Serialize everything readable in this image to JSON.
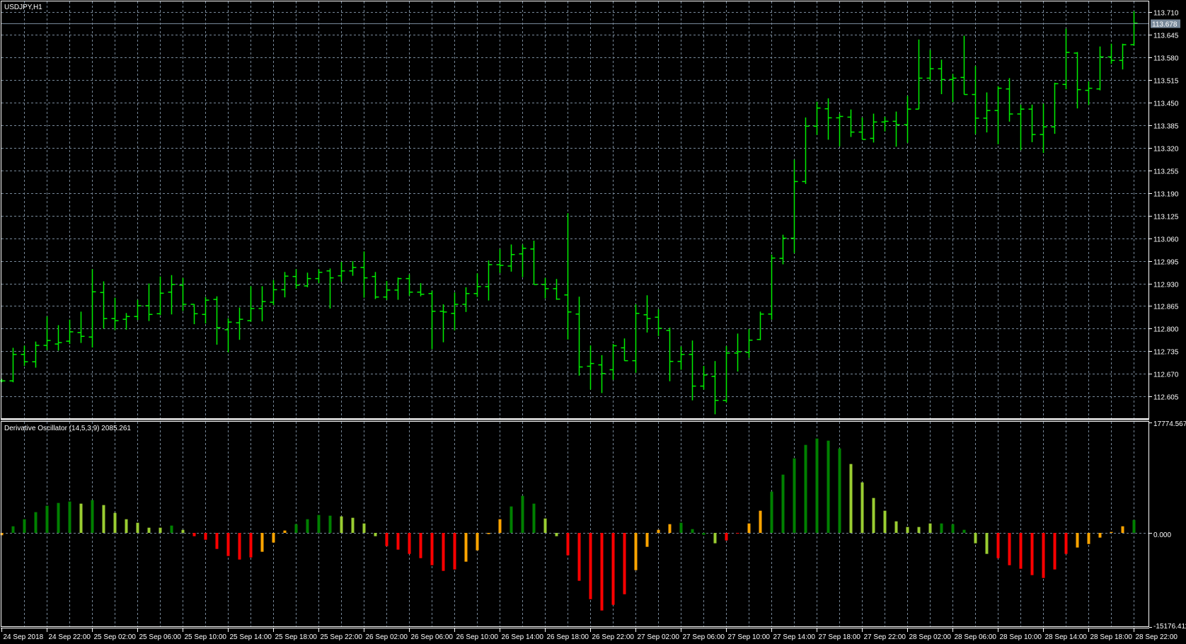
{
  "window": {
    "symbol_label": "USDJPY,H1",
    "indicator_label": "Derivative Oscillator (14,5,3,9) 2085.261"
  },
  "colors": {
    "background": "#000000",
    "grid": "#778899",
    "bar": "#00ee00",
    "osc_up_strong": "#008000",
    "osc_up_weak": "#9acd32",
    "osc_down_strong": "#ff0000",
    "osc_down_weak": "#ffa500",
    "price_line": "#778899"
  },
  "chart_data": [
    {
      "type": "ohlc",
      "title": "USDJPY,H1",
      "ylim": [
        112.57,
        113.74
      ],
      "price_ticks": [
        "113.710",
        "113.645",
        "113.580",
        "113.515",
        "113.450",
        "113.385",
        "113.320",
        "113.255",
        "113.190",
        "113.125",
        "113.060",
        "112.995",
        "112.930",
        "112.865",
        "112.800",
        "112.735",
        "112.670",
        "112.605"
      ],
      "current_price": "113.678",
      "time_labels": [
        {
          "bar": 0,
          "text": "24 Sep 2018"
        },
        {
          "bar": 4,
          "text": "24 Sep 22:00"
        },
        {
          "bar": 8,
          "text": "25 Sep 02:00"
        },
        {
          "bar": 12,
          "text": "25 Sep 06:00"
        },
        {
          "bar": 16,
          "text": "25 Sep 10:00"
        },
        {
          "bar": 20,
          "text": "25 Sep 14:00"
        },
        {
          "bar": 24,
          "text": "25 Sep 18:00"
        },
        {
          "bar": 28,
          "text": "25 Sep 22:00"
        },
        {
          "bar": 32,
          "text": "26 Sep 02:00"
        },
        {
          "bar": 36,
          "text": "26 Sep 06:00"
        },
        {
          "bar": 40,
          "text": "26 Sep 10:00"
        },
        {
          "bar": 44,
          "text": "26 Sep 14:00"
        },
        {
          "bar": 48,
          "text": "26 Sep 18:00"
        },
        {
          "bar": 52,
          "text": "26 Sep 22:00"
        },
        {
          "bar": 56,
          "text": "27 Sep 02:00"
        },
        {
          "bar": 60,
          "text": "27 Sep 06:00"
        },
        {
          "bar": 64,
          "text": "27 Sep 10:00"
        },
        {
          "bar": 68,
          "text": "27 Sep 14:00"
        },
        {
          "bar": 72,
          "text": "27 Sep 18:00"
        },
        {
          "bar": 76,
          "text": "27 Sep 22:00"
        },
        {
          "bar": 80,
          "text": "28 Sep 02:00"
        },
        {
          "bar": 84,
          "text": "28 Sep 06:00"
        },
        {
          "bar": 88,
          "text": "28 Sep 10:00"
        },
        {
          "bar": 92,
          "text": "28 Sep 14:00"
        },
        {
          "bar": 96,
          "text": "28 Sep 18:00"
        },
        {
          "bar": 100,
          "text": "28 Sep 22:00"
        }
      ],
      "ohlc": [
        [
          112.65,
          112.656,
          112.646,
          112.65
        ],
        [
          112.65,
          112.745,
          112.646,
          112.726
        ],
        [
          112.726,
          112.751,
          112.693,
          112.705
        ],
        [
          112.705,
          112.763,
          112.688,
          112.752
        ],
        [
          112.752,
          112.835,
          112.739,
          112.766
        ],
        [
          112.756,
          112.81,
          112.737,
          112.76
        ],
        [
          112.764,
          112.826,
          112.756,
          112.791
        ],
        [
          112.789,
          112.849,
          112.759,
          112.778
        ],
        [
          112.776,
          112.971,
          112.746,
          112.906
        ],
        [
          112.904,
          112.936,
          112.8,
          112.829
        ],
        [
          112.829,
          112.889,
          112.796,
          112.823
        ],
        [
          112.827,
          112.845,
          112.797,
          112.835
        ],
        [
          112.835,
          112.883,
          112.825,
          112.866
        ],
        [
          112.866,
          112.93,
          112.822,
          112.841
        ],
        [
          112.843,
          112.95,
          112.839,
          112.902
        ],
        [
          112.905,
          112.954,
          112.841,
          112.927
        ],
        [
          112.925,
          112.946,
          112.851,
          112.87
        ],
        [
          112.87,
          112.87,
          112.813,
          112.843
        ],
        [
          112.841,
          112.891,
          112.815,
          112.882
        ],
        [
          112.884,
          112.893,
          112.754,
          112.803
        ],
        [
          112.797,
          112.83,
          112.732,
          112.819
        ],
        [
          112.817,
          112.861,
          112.768,
          112.827
        ],
        [
          112.823,
          112.922,
          112.82,
          112.858
        ],
        [
          112.858,
          112.922,
          112.821,
          112.878
        ],
        [
          112.876,
          112.94,
          112.868,
          112.912
        ],
        [
          112.912,
          112.963,
          112.89,
          112.951
        ],
        [
          112.95,
          112.971,
          112.915,
          112.925
        ],
        [
          112.923,
          112.961,
          112.919,
          112.944
        ],
        [
          112.944,
          112.971,
          112.931,
          112.962
        ],
        [
          112.966,
          112.973,
          112.858,
          112.946
        ],
        [
          112.952,
          112.992,
          112.935,
          112.966
        ],
        [
          112.966,
          112.994,
          112.952,
          112.976
        ],
        [
          112.976,
          113.022,
          112.889,
          112.946
        ],
        [
          112.95,
          112.963,
          112.885,
          112.891
        ],
        [
          112.891,
          112.937,
          112.883,
          112.911
        ],
        [
          112.911,
          112.947,
          112.883,
          112.944
        ],
        [
          112.944,
          112.956,
          112.895,
          112.905
        ],
        [
          112.905,
          112.931,
          112.893,
          112.899
        ],
        [
          112.901,
          112.909,
          112.741,
          112.85
        ],
        [
          112.85,
          112.87,
          112.761,
          112.848
        ],
        [
          112.844,
          112.904,
          112.795,
          112.87
        ],
        [
          112.87,
          112.919,
          112.848,
          112.901
        ],
        [
          112.901,
          112.959,
          112.891,
          112.921
        ],
        [
          112.921,
          112.996,
          112.881,
          112.984
        ],
        [
          112.984,
          113.029,
          112.96,
          112.982
        ],
        [
          112.98,
          113.042,
          112.964,
          113.013
        ],
        [
          113.015,
          113.042,
          112.948,
          113.031
        ],
        [
          113.029,
          113.053,
          112.927,
          112.927
        ],
        [
          112.927,
          112.946,
          112.887,
          112.915
        ],
        [
          112.915,
          112.943,
          112.883,
          112.885
        ],
        [
          112.897,
          113.132,
          112.769,
          112.848
        ],
        [
          112.842,
          112.892,
          112.665,
          112.69
        ],
        [
          112.692,
          112.752,
          112.625,
          112.7
        ],
        [
          112.696,
          112.724,
          112.615,
          112.671
        ],
        [
          112.682,
          112.756,
          112.653,
          112.751
        ],
        [
          112.745,
          112.772,
          112.708,
          112.708
        ],
        [
          112.708,
          112.87,
          112.673,
          112.844
        ],
        [
          112.84,
          112.896,
          112.789,
          112.829
        ],
        [
          112.833,
          112.856,
          112.779,
          112.801
        ],
        [
          112.795,
          112.803,
          112.649,
          112.706
        ],
        [
          112.706,
          112.749,
          112.682,
          112.726
        ],
        [
          112.726,
          112.766,
          112.594,
          112.635
        ],
        [
          112.635,
          112.693,
          112.625,
          112.667
        ],
        [
          112.663,
          112.707,
          112.554,
          112.594
        ],
        [
          112.594,
          112.75,
          112.588,
          112.73
        ],
        [
          112.73,
          112.786,
          112.677,
          112.734
        ],
        [
          112.732,
          112.799,
          112.716,
          112.767
        ],
        [
          112.769,
          112.849,
          112.767,
          112.842
        ],
        [
          112.842,
          113.013,
          112.826,
          113.003
        ],
        [
          113.002,
          113.07,
          112.985,
          113.06
        ],
        [
          113.06,
          113.286,
          113.017,
          113.223
        ],
        [
          113.223,
          113.407,
          113.216,
          113.382
        ],
        [
          113.382,
          113.452,
          113.357,
          113.434
        ],
        [
          113.432,
          113.462,
          113.343,
          113.406
        ],
        [
          113.406,
          113.418,
          113.324,
          113.41
        ],
        [
          113.408,
          113.43,
          113.351,
          113.365
        ],
        [
          113.365,
          113.407,
          113.344,
          113.344
        ],
        [
          113.347,
          113.418,
          113.335,
          113.394
        ],
        [
          113.394,
          113.409,
          113.367,
          113.396
        ],
        [
          113.396,
          113.424,
          113.323,
          113.386
        ],
        [
          113.386,
          113.469,
          113.334,
          113.431
        ],
        [
          113.431,
          113.631,
          113.431,
          113.52
        ],
        [
          113.52,
          113.601,
          113.512,
          113.547
        ],
        [
          113.547,
          113.573,
          113.474,
          113.516
        ],
        [
          113.516,
          113.532,
          113.451,
          113.52
        ],
        [
          113.522,
          113.642,
          113.473,
          113.473
        ],
        [
          113.473,
          113.555,
          113.359,
          113.405
        ],
        [
          113.405,
          113.479,
          113.364,
          113.427
        ],
        [
          113.427,
          113.497,
          113.33,
          113.491
        ],
        [
          113.489,
          113.52,
          113.395,
          113.417
        ],
        [
          113.417,
          113.444,
          113.313,
          113.431
        ],
        [
          113.431,
          113.444,
          113.336,
          113.358
        ],
        [
          113.358,
          113.447,
          113.305,
          113.38
        ],
        [
          113.38,
          113.507,
          113.36,
          113.504
        ],
        [
          113.502,
          113.662,
          113.488,
          113.594
        ],
        [
          113.592,
          113.595,
          113.433,
          113.487
        ],
        [
          113.485,
          113.511,
          113.443,
          113.491
        ],
        [
          113.489,
          113.611,
          113.485,
          113.581
        ],
        [
          113.581,
          113.619,
          113.561,
          113.571
        ],
        [
          113.571,
          113.619,
          113.545,
          113.616
        ],
        [
          113.616,
          113.712,
          113.614,
          113.678
        ]
      ]
    },
    {
      "type": "bar",
      "title": "Derivative Oscillator (14,5,3,9)",
      "last_value": "2085.261",
      "ylim": [
        -15176.411,
        17774.567
      ],
      "scale_labels": {
        "max": "17774.567",
        "zero": "0.000",
        "min": "-15176.411"
      },
      "values": [
        -380,
        1064,
        2204,
        3344,
        4370,
        4826,
        5054,
        4712,
        5282,
        4484,
        3230,
        2204,
        1634,
        836,
        836,
        1178,
        494,
        -532,
        -1102,
        -2584,
        -3724,
        -4294,
        -3952,
        -3040,
        -1558,
        380,
        1406,
        2204,
        2888,
        2774,
        2660,
        2432,
        1520,
        -532,
        -2128,
        -2698,
        -3382,
        -4066,
        -5206,
        -6118,
        -5890,
        -4636,
        -2812,
        -190,
        2204,
        4256,
        5966,
        4712,
        2318,
        -532,
        -3610,
        -7714,
        -10678,
        -12502,
        -11590,
        -9880,
        -6004,
        -2242,
        494,
        1406,
        1634,
        608,
        -304,
        -1672,
        -1216,
        -76,
        1520,
        3572,
        6650,
        9386,
        12008,
        14174,
        15200,
        14858,
        13604,
        11096,
        8132,
        5624,
        3572,
        1862,
        950,
        950,
        1520,
        1520,
        1406,
        494,
        -1672,
        -3382,
        -4066,
        -5206,
        -5776,
        -6802,
        -7258,
        -5890,
        -3382,
        -2356,
        -1786,
        -760,
        152,
        1064,
        2085.261
      ],
      "color_keys": "OGGGGGGLGLLLLLLGLRRRRRROOOGGGGLLLLRRRRRRROOOOGGGLLRRRRRROOOOGGGLRROOGGGGGGGLLLLLLLLGGGLLRRRRRRROOOOOGGG"
    }
  ]
}
